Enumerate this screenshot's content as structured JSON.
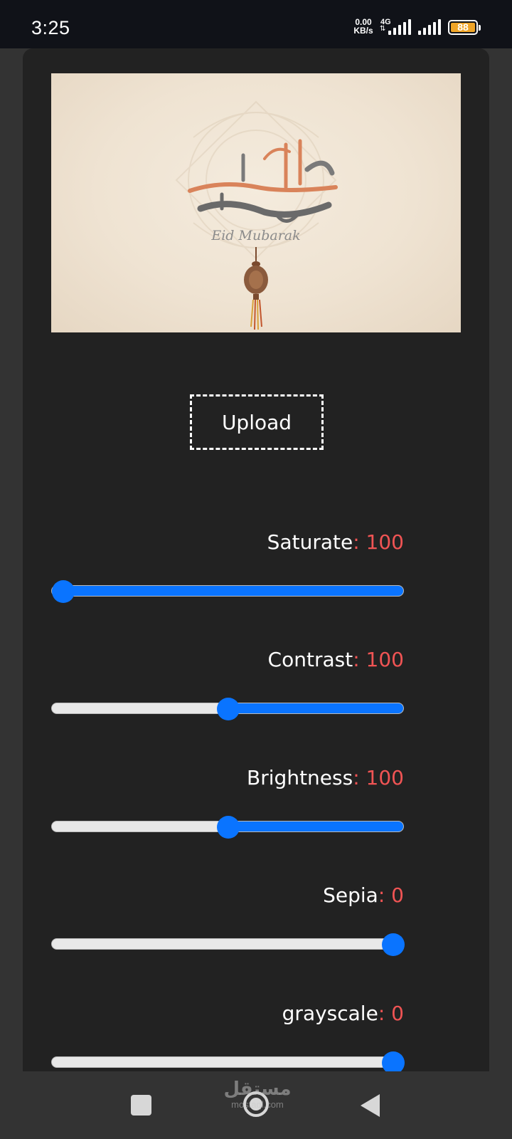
{
  "status_bar": {
    "time": "3:25",
    "net_speed_value": "0.00",
    "net_speed_unit": "KB/s",
    "network_type": "4G",
    "battery_level": "88",
    "battery_color": "#f0a528"
  },
  "image_preview": {
    "arabic_text": "عيد أضحى مبارك",
    "english_text": "Eid Mubarak"
  },
  "upload": {
    "label": "Upload"
  },
  "controls": [
    {
      "name": "Saturate",
      "value": "100",
      "slider_position": 0.0
    },
    {
      "name": "Contrast",
      "value": "100",
      "slider_position": 0.5
    },
    {
      "name": "Brightness",
      "value": "100",
      "slider_position": 0.5
    },
    {
      "name": "Sepia",
      "value": "0",
      "slider_position": 1.0
    },
    {
      "name": "grayscale",
      "value": "0",
      "slider_position": 1.0
    }
  ],
  "colors": {
    "accent": "#0a74ff",
    "value_text": "#f05454",
    "card_background": "#222222",
    "page_background": "#333333"
  },
  "watermark": {
    "arabic": "مستقل",
    "latin": "mostaql.com"
  },
  "nav_bar": {
    "icons": [
      "recents-icon",
      "home-icon",
      "back-icon"
    ]
  }
}
